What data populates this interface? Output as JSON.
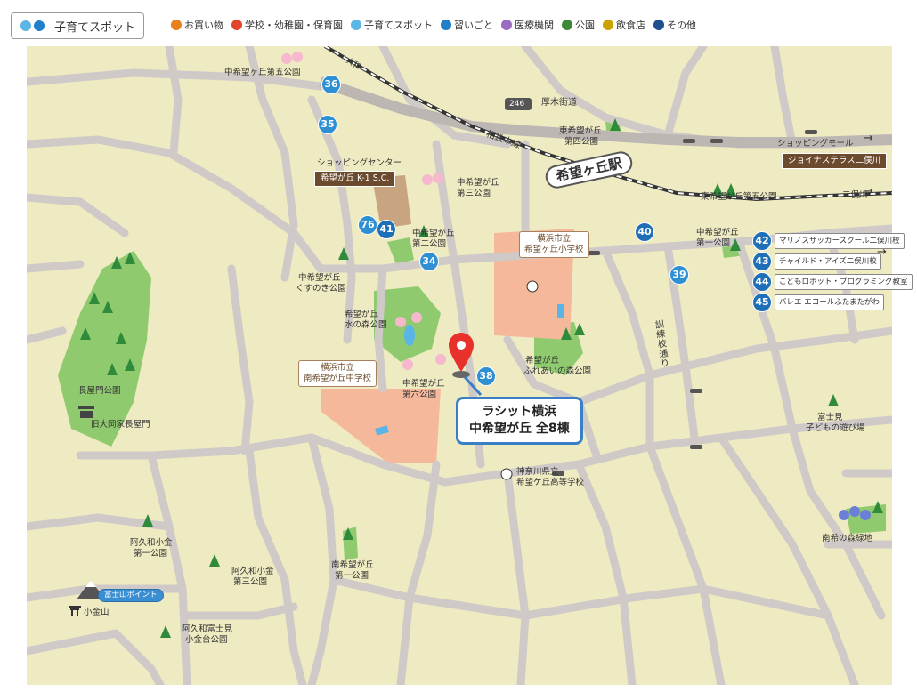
{
  "legend": {
    "box_label": "子育てスポット",
    "items": [
      {
        "label": "お買い物",
        "color": "#e8801e"
      },
      {
        "label": "学校・幼稚園・保育園",
        "color": "#e0452c"
      },
      {
        "label": "子育てスポット",
        "color": "#5bb6e6"
      },
      {
        "label": "習いごと",
        "color": "#1f7fc8"
      },
      {
        "label": "医療機関",
        "color": "#9b6bc2"
      },
      {
        "label": "公園",
        "color": "#3a8a3a"
      },
      {
        "label": "飲食店",
        "color": "#c9a400"
      },
      {
        "label": "その他",
        "color": "#1f4f8f"
      }
    ]
  },
  "colors": {
    "map_bg": "#eeeac1",
    "road": "#cfcac8",
    "park": "#8fcb6e",
    "school": "#f5b89a",
    "spot_blue": "#2e8fd3",
    "pin": "#e8312a"
  },
  "roads": {
    "route": "246",
    "atsugi": "厚木街道",
    "sotetsu": "相鉄本線",
    "yamato": "大和",
    "futamatagawa": "二俣川",
    "kunren": "訓練校通り"
  },
  "station": "希望ヶ丘駅",
  "shopping_mall": {
    "caption": "ショッピングモール",
    "name": "ジョイナステラス二俣川"
  },
  "shopping_center": {
    "caption": "ショッピングセンター",
    "name": "希望が丘 K-1 S.C."
  },
  "property": {
    "line1": "ラシット横浜",
    "line2": "中希望が丘 全8棟"
  },
  "schools": {
    "elementary": {
      "line1": "横浜市立",
      "line2": "希望ヶ丘小学校"
    },
    "junior_high": {
      "line1": "横浜市立",
      "line2": "南希望が丘中学校"
    },
    "high": {
      "line1": "神奈川県立",
      "line2": "希望ケ丘高等学校"
    }
  },
  "parks": {
    "naka5": "中希望ヶ丘第五公園",
    "higashi4_1": "東希望が丘",
    "higashi4_2": "第四公園",
    "higashi5": "東希望が丘第五公園",
    "naka3_1": "中希望が丘",
    "naka3_2": "第三公園",
    "naka2_1": "中希望が丘",
    "naka2_2": "第二公園",
    "kusunoki_1": "中希望が丘",
    "kusunoki_2": "くすのき公園",
    "mizunomori_1": "希望が丘",
    "mizunomori_2": "水の森公園",
    "naka6_1": "中希望が丘",
    "naka6_2": "第六公園",
    "fureai_1": "希望が丘",
    "fureai_2": "ふれあいの森公園",
    "naka1_1": "中希望が丘",
    "naka1_2": "第一公園",
    "nagayamon": "長屋門公園",
    "nagayamon_house": "旧大岡家長屋門",
    "akuwa1_1": "阿久和小金",
    "akuwa1_2": "第一公園",
    "akuwa3_1": "阿久和小金",
    "akuwa3_2": "第三公園",
    "minami1_1": "南希望が丘",
    "minami1_2": "第一公園",
    "akuwa_fuji_1": "阿久和富士見",
    "akuwa_fuji_2": "小金台公園",
    "fujimi_1": "富士見",
    "fujimi_2": "子どもの遊び場",
    "minamino": "南希の森緑地"
  },
  "fuji_point": "富士山ポイント",
  "koganeyama": "小金山",
  "spots": [
    {
      "num": "36"
    },
    {
      "num": "35"
    },
    {
      "num": "76"
    },
    {
      "num": "41"
    },
    {
      "num": "34"
    },
    {
      "num": "38"
    },
    {
      "num": "40"
    },
    {
      "num": "39"
    }
  ],
  "lessons": [
    {
      "num": "42",
      "label": "マリノスサッカースクール二俣川校"
    },
    {
      "num": "43",
      "label": "チャイルド・アイズ二俣川校"
    },
    {
      "num": "44",
      "label": "こどもロボット・プログラミング教室"
    },
    {
      "num": "45",
      "label": "バレエ エコールふたまたがわ"
    }
  ]
}
